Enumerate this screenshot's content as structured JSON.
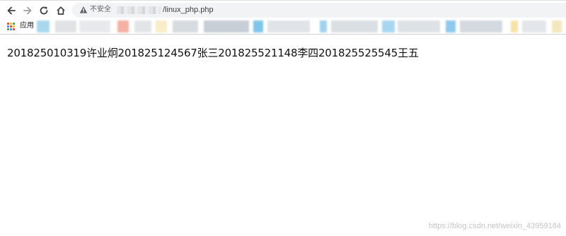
{
  "toolbar": {
    "security_label": "不安全",
    "url_path": "/linux_php.php"
  },
  "bookmarks": {
    "apps_label": "应用"
  },
  "page": {
    "output_text": "201825010319许业炯201825124567张三201825521148李四201825525545王五"
  },
  "watermark": "https://blog.csdn.net/weixin_43959184",
  "icons": [
    "back-arrow-icon",
    "forward-arrow-icon",
    "reload-icon",
    "home-icon",
    "warning-triangle-icon",
    "apps-grid-icon"
  ],
  "colors": {
    "omnibox_bg": "#f1f3f4",
    "text": "#111111",
    "muted": "#5f6368"
  }
}
